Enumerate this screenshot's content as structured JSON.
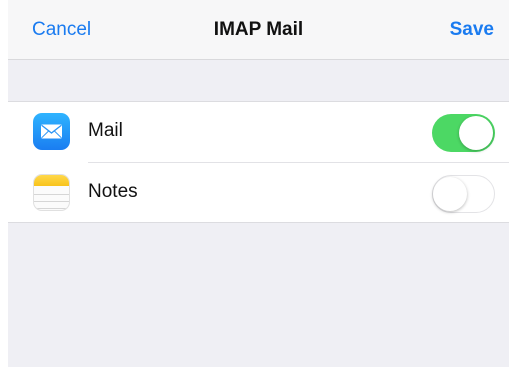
{
  "nav": {
    "cancel_label": "Cancel",
    "title": "IMAP Mail",
    "save_label": "Save"
  },
  "colors": {
    "accent": "#1a7bf0",
    "toggle_on": "#4cd864",
    "grouped_background": "#efeff4"
  },
  "items": [
    {
      "label": "Mail",
      "icon": "mail-icon",
      "enabled": true
    },
    {
      "label": "Notes",
      "icon": "notes-icon",
      "enabled": false
    }
  ]
}
